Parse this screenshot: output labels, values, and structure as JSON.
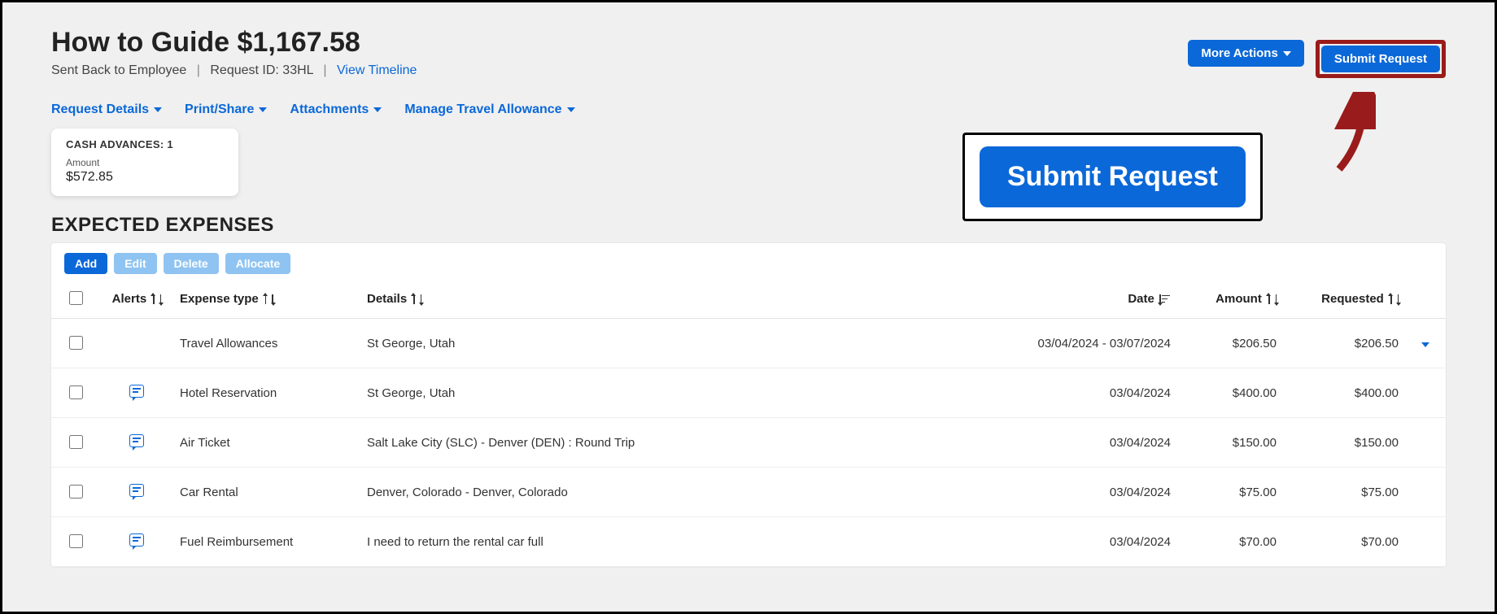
{
  "header": {
    "title": "How to Guide $1,167.58",
    "status": "Sent Back to Employee",
    "request_id_label": "Request ID: 33HL",
    "view_timeline": "View Timeline",
    "more_actions": "More Actions",
    "submit_request": "Submit Request"
  },
  "toolbar": {
    "request_details": "Request Details",
    "print_share": "Print/Share",
    "attachments": "Attachments",
    "manage_travel_allowance": "Manage Travel Allowance"
  },
  "cash_advances": {
    "title": "CASH ADVANCES: 1",
    "amount_label": "Amount",
    "amount_value": "$572.85"
  },
  "section_title": "EXPECTED EXPENSES",
  "table_actions": {
    "add": "Add",
    "edit": "Edit",
    "delete": "Delete",
    "allocate": "Allocate"
  },
  "columns": {
    "alerts": "Alerts",
    "expense_type": "Expense type",
    "details": "Details",
    "date": "Date",
    "amount": "Amount",
    "requested": "Requested"
  },
  "rows": [
    {
      "has_comment": false,
      "expense_type": "Travel Allowances",
      "details": "St George, Utah",
      "date": "03/04/2024 - 03/07/2024",
      "amount": "$206.50",
      "requested": "$206.50",
      "expandable": true
    },
    {
      "has_comment": true,
      "expense_type": "Hotel Reservation",
      "details": "St George, Utah",
      "date": "03/04/2024",
      "amount": "$400.00",
      "requested": "$400.00",
      "expandable": false
    },
    {
      "has_comment": true,
      "expense_type": "Air Ticket",
      "details": "Salt Lake City (SLC) - Denver (DEN) : Round Trip",
      "date": "03/04/2024",
      "amount": "$150.00",
      "requested": "$150.00",
      "expandable": false
    },
    {
      "has_comment": true,
      "expense_type": "Car Rental",
      "details": "Denver, Colorado - Denver, Colorado",
      "date": "03/04/2024",
      "amount": "$75.00",
      "requested": "$75.00",
      "expandable": false
    },
    {
      "has_comment": true,
      "expense_type": "Fuel Reimbursement",
      "details": "I need to return the rental car full",
      "date": "03/04/2024",
      "amount": "$70.00",
      "requested": "$70.00",
      "expandable": false
    }
  ],
  "callout": {
    "submit_big": "Submit Request"
  }
}
